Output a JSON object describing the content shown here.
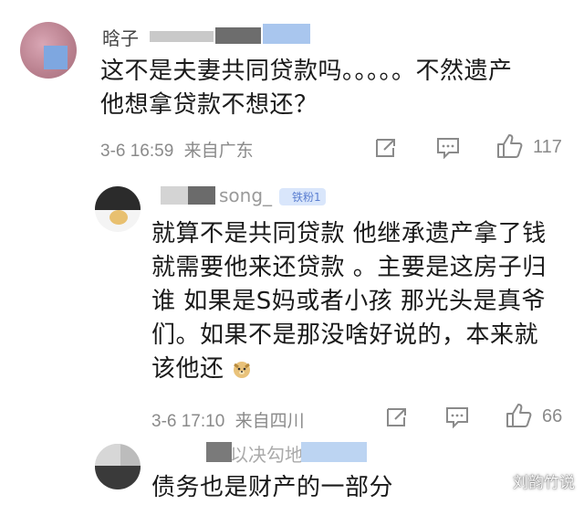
{
  "comments": [
    {
      "username_visible": "晗子",
      "text_lines": [
        "这不是夫妻共同贷款吗。。。。。不然遗产",
        "他想拿贷款不想还？"
      ],
      "timestamp": "3-6 16:59",
      "location": "来自广东",
      "like_count": "117"
    },
    {
      "username_visible": "song_",
      "badge": "铁粉1",
      "text_lines": [
        "就算不是共同贷款 他继承遗产拿了钱",
        "就需要他来还贷款 。主要是这房子归",
        "谁 如果是S妈或者小孩 那光头是真爷",
        "们。如果不是那没啥好说的，本来就",
        "该他还"
      ],
      "timestamp": "3-6 17:10",
      "location": "来自四川",
      "like_count": "66"
    },
    {
      "username_visible": "以决勾地",
      "text_lines": [
        "债务也是财产的一部分"
      ]
    }
  ],
  "icons": {
    "share": "share-icon",
    "comment": "comment-icon",
    "like": "thumbs-up-icon",
    "emoji": "doge-emoji-icon"
  },
  "watermark": "刘韵竹说",
  "colors": {
    "meta_gray": "#8a8a8a",
    "badge_bg": "#d9e6fb",
    "badge_text": "#5b7fd1"
  }
}
